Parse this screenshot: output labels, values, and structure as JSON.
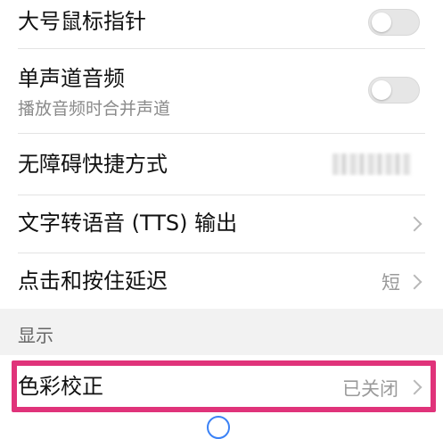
{
  "settings": {
    "large_pointer": {
      "label": "大号鼠标指针"
    },
    "mono_audio": {
      "label": "单声道音频",
      "sub": "播放音频时合并声道"
    },
    "shortcut": {
      "label": "无障碍快捷方式"
    },
    "tts": {
      "label": "文字转语音 (TTS) 输出"
    },
    "touch_hold": {
      "label": "点击和按住延迟",
      "value": "短"
    }
  },
  "section_display": {
    "label": "显示"
  },
  "color_correction": {
    "label": "色彩校正",
    "value": "已关闭"
  }
}
